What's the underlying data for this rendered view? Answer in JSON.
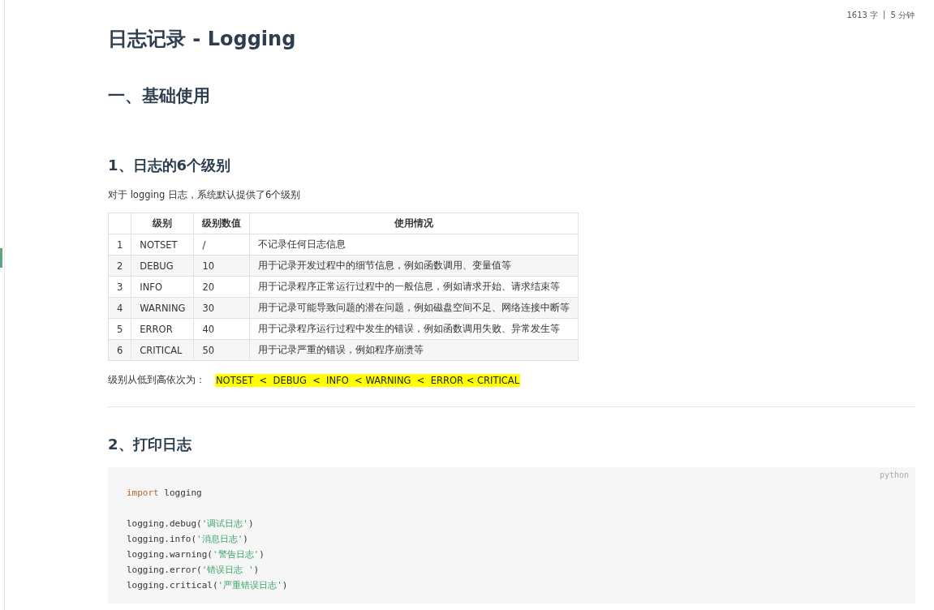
{
  "word_count": {
    "words": "1613 字",
    "separator": "|",
    "time": "5 分钟"
  },
  "title": "日志记录 - Logging",
  "section": "一、基础使用",
  "subsection_1": "1、日志的6个级别",
  "intro": "对于 logging 日志，系统默认提供了6个级别",
  "table": {
    "columns": [
      "",
      "级别",
      "级别数值",
      "使用情况"
    ],
    "rows": [
      [
        "1",
        "NOTSET",
        "/",
        "不记录任何日志信息"
      ],
      [
        "2",
        "DEBUG",
        "10",
        "用于记录开发过程中的细节信息，例如函数调用、变量值等"
      ],
      [
        "3",
        "INFO",
        "20",
        "用于记录程序正常运行过程中的一般信息，例如请求开始、请求结束等"
      ],
      [
        "4",
        "WARNING",
        "30",
        "用于记录可能导致问题的潜在问题，例如磁盘空间不足、网络连接中断等"
      ],
      [
        "5",
        "ERROR",
        "40",
        "用于记录程序运行过程中发生的错误，例如函数调用失败、异常发生等"
      ],
      [
        "6",
        "CRITICAL",
        "50",
        "用于记录严重的错误，例如程序崩溃等"
      ]
    ]
  },
  "order": {
    "label": "级别从低到高依次为：",
    "highlight": "NOTSET  <  DEBUG  <  INFO  < WARNING  <  ERROR < CRITICAL"
  },
  "subsection_2": "2、打印日志",
  "code": {
    "language": "python",
    "blocks": [
      [
        {
          "tokens": [
            {
              "kind": "keyword",
              "text": "import"
            },
            {
              "kind": "plain",
              "text": " logging"
            }
          ]
        }
      ],
      [
        {
          "tokens": [
            {
              "kind": "plain",
              "text": "logging.debug("
            },
            {
              "kind": "string",
              "text": "'调试日志'"
            },
            {
              "kind": "plain",
              "text": ")"
            }
          ]
        },
        {
          "tokens": [
            {
              "kind": "plain",
              "text": "logging.info("
            },
            {
              "kind": "string",
              "text": "'消息日志'"
            },
            {
              "kind": "plain",
              "text": ")"
            }
          ]
        },
        {
          "tokens": [
            {
              "kind": "plain",
              "text": "logging.warning("
            },
            {
              "kind": "string",
              "text": "'警告日志'"
            },
            {
              "kind": "plain",
              "text": ")"
            }
          ]
        },
        {
          "tokens": [
            {
              "kind": "plain",
              "text": "logging.error("
            },
            {
              "kind": "string",
              "text": "'错误日志 '"
            },
            {
              "kind": "plain",
              "text": ")"
            }
          ]
        },
        {
          "tokens": [
            {
              "kind": "plain",
              "text": "logging.critical("
            },
            {
              "kind": "string",
              "text": "'严重错误日志'"
            },
            {
              "kind": "plain",
              "text": ")"
            }
          ]
        }
      ]
    ]
  }
}
